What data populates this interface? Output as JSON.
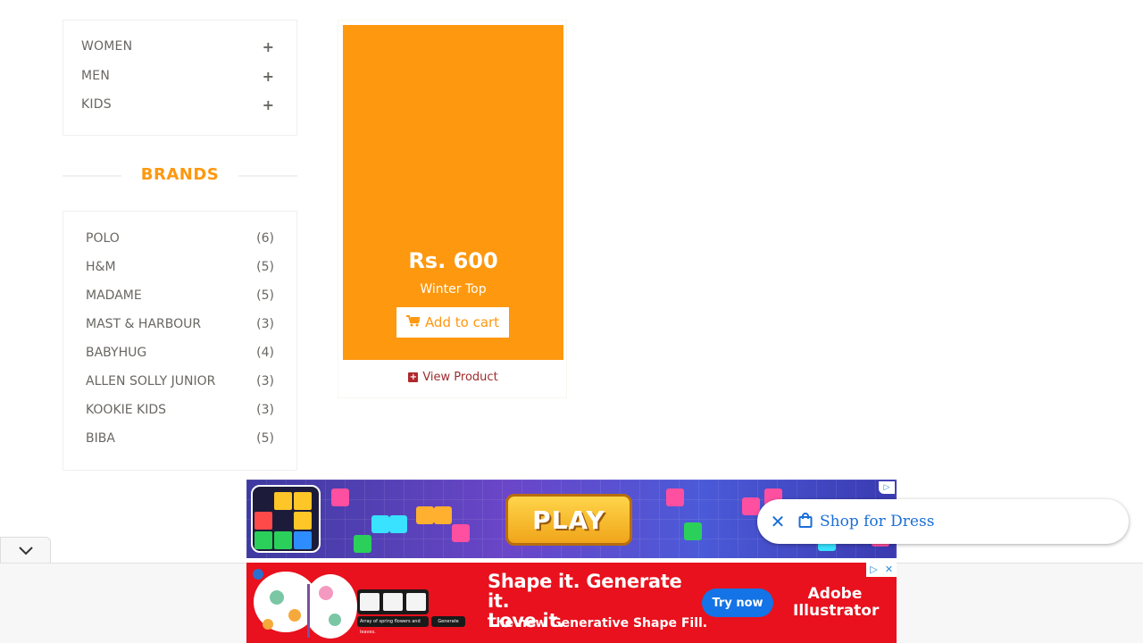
{
  "categories": [
    {
      "label": "WOMEN",
      "icon": "plus-icon"
    },
    {
      "label": "MEN",
      "icon": "plus-icon"
    },
    {
      "label": "KIDS",
      "icon": "plus-icon"
    }
  ],
  "brands": {
    "title": "BRANDS",
    "items": [
      {
        "name": "POLO",
        "count": "(6)"
      },
      {
        "name": "H&M",
        "count": "(5)"
      },
      {
        "name": "MADAME",
        "count": "(5)"
      },
      {
        "name": "MAST & HARBOUR",
        "count": "(3)"
      },
      {
        "name": "BABYHUG",
        "count": "(4)"
      },
      {
        "name": "ALLEN SOLLY JUNIOR",
        "count": "(3)"
      },
      {
        "name": "KOOKIE KIDS",
        "count": "(3)"
      },
      {
        "name": "BIBA",
        "count": "(5)"
      }
    ]
  },
  "product": {
    "price": "Rs. 600",
    "name": "Winter Top",
    "add_to_cart": "Add to cart",
    "view_product": "View Product",
    "overlay_color": "#fe980f"
  },
  "ads": {
    "game_play_label": "PLAY",
    "shop_pill_text": "Shop for Dress",
    "adobe_headline_1": "Shape it. Generate it.",
    "adobe_headline_2": "Love it.",
    "adobe_sub": "The new Generative Shape Fill.",
    "adobe_cta": "Try now",
    "adobe_brand_1": "Adobe",
    "adobe_brand_2": "Illustrator",
    "adobe_caption": "Array of spring flowers and leaves.",
    "adobe_generate": "Generate"
  },
  "colors": {
    "accent": "#fe980f",
    "text_gray": "#696763",
    "link_red": "#9e2b2b",
    "adobe_red": "#e8111d",
    "cta_blue": "#1473e6"
  }
}
